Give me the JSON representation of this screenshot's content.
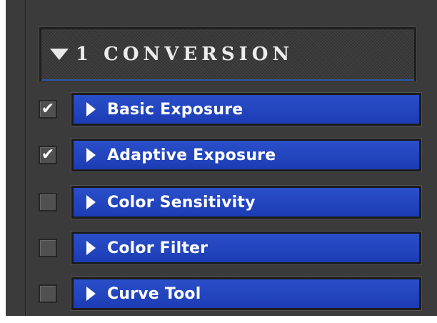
{
  "section": {
    "label": "1 CONVERSION",
    "expanded": true,
    "expand_icon": "triangle-down-icon"
  },
  "colors": {
    "panel_bg": "#3b3b3b",
    "bar_blue": "#1f42bd",
    "text": "#ffffff"
  },
  "items": [
    {
      "label": "Basic Exposure",
      "checked": true,
      "check_mark": "✔",
      "icon": "triangle-right-icon"
    },
    {
      "label": "Adaptive Exposure",
      "checked": true,
      "check_mark": "✔",
      "icon": "triangle-right-icon"
    },
    {
      "label": "Color Sensitivity",
      "checked": false,
      "check_mark": "",
      "icon": "triangle-right-icon"
    },
    {
      "label": "Color Filter",
      "checked": false,
      "check_mark": "",
      "icon": "triangle-right-icon"
    },
    {
      "label": "Curve Tool",
      "checked": false,
      "check_mark": "",
      "icon": "triangle-right-icon"
    }
  ]
}
